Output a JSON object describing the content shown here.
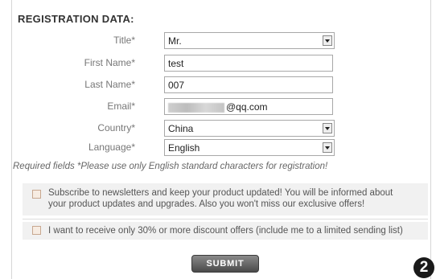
{
  "form": {
    "section_title": "REGISTRATION DATA:",
    "fields": {
      "title": {
        "label": "Title*",
        "value": "Mr.",
        "type": "select"
      },
      "first_name": {
        "label": "First Name*",
        "value": "test",
        "type": "text"
      },
      "last_name": {
        "label": "Last Name*",
        "value": "007",
        "type": "text"
      },
      "email": {
        "label": "Email*",
        "value_suffix": "@qq.com",
        "type": "text"
      },
      "country": {
        "label": "Country*",
        "value": "China",
        "type": "select"
      },
      "language": {
        "label": "Language*",
        "value": "English",
        "type": "select"
      }
    },
    "required_note": "Required fields *Please use only English standard characters for registration!",
    "newsletter_line1": "Subscribe to newsletters and keep your product updated! You will be informed about",
    "newsletter_line2": "your product updates and upgrades. Also you won't miss our exclusive offers!",
    "discount_text": "I want to receive only 30% or more discount offers (include me to a limited sending list)",
    "submit_label": "SUBMIT",
    "step_badge": "2"
  }
}
